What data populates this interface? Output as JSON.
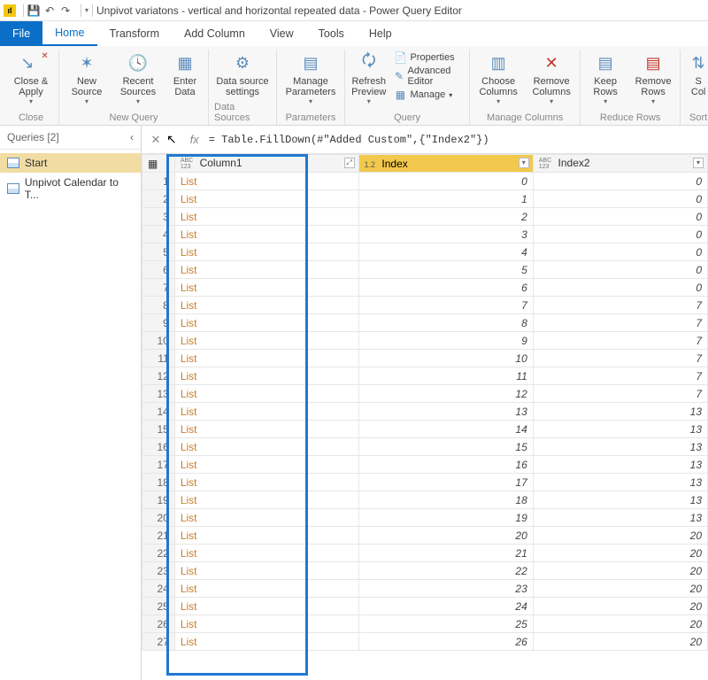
{
  "titlebar": {
    "app_icon": "▮",
    "title": "Unpivot variatons  - vertical and horizontal repeated data - Power Query Editor",
    "qat_save": "💾",
    "qat_undo": "↶",
    "qat_redo": "↷",
    "qat_dropdown": "▾"
  },
  "tabs": {
    "file": "File",
    "home": "Home",
    "transform": "Transform",
    "addcolumn": "Add Column",
    "view": "View",
    "tools": "Tools",
    "help": "Help"
  },
  "ribbon": {
    "close_apply": "Close &\nApply",
    "close_grp": "Close",
    "new_source": "New\nSource",
    "recent_sources": "Recent\nSources",
    "enter_data": "Enter\nData",
    "newquery_grp": "New Query",
    "ds_settings": "Data source\nsettings",
    "ds_grp": "Data Sources",
    "manage_params": "Manage\nParameters",
    "params_grp": "Parameters",
    "refresh_preview": "Refresh\nPreview",
    "properties": "Properties",
    "adv_editor": "Advanced Editor",
    "manage": "Manage",
    "query_grp": "Query",
    "choose_cols": "Choose\nColumns",
    "remove_cols": "Remove\nColumns",
    "mcols_grp": "Manage Columns",
    "keep_rows": "Keep\nRows",
    "remove_rows": "Remove\nRows",
    "rrows_grp": "Reduce Rows",
    "sort_cols": "S\nCol",
    "sort_grp": "Sort"
  },
  "queries": {
    "header": "Queries [2]",
    "collapse": "‹",
    "items": [
      {
        "label": "Start",
        "selected": true
      },
      {
        "label": "Unpivot Calendar to T...",
        "selected": false
      }
    ]
  },
  "formula": {
    "cancel": "✕",
    "accept": "✓",
    "fx": "fx",
    "text": "= Table.FillDown(#\"Added Custom\",{\"Index2\"})"
  },
  "grid": {
    "headers": {
      "rowcorner": "",
      "col1_type": "ABC\n123",
      "col1": "Column1",
      "col1_expander": "⤢",
      "index_type": "1.2",
      "index": "Index",
      "index2_type": "ABC\n123",
      "index2": "Index2",
      "drop": "▾"
    },
    "rows": [
      {
        "n": 1,
        "c1": "List",
        "i": 0,
        "i2": 0
      },
      {
        "n": 2,
        "c1": "List",
        "i": 1,
        "i2": 0
      },
      {
        "n": 3,
        "c1": "List",
        "i": 2,
        "i2": 0
      },
      {
        "n": 4,
        "c1": "List",
        "i": 3,
        "i2": 0
      },
      {
        "n": 5,
        "c1": "List",
        "i": 4,
        "i2": 0
      },
      {
        "n": 6,
        "c1": "List",
        "i": 5,
        "i2": 0
      },
      {
        "n": 7,
        "c1": "List",
        "i": 6,
        "i2": 0
      },
      {
        "n": 8,
        "c1": "List",
        "i": 7,
        "i2": 7
      },
      {
        "n": 9,
        "c1": "List",
        "i": 8,
        "i2": 7
      },
      {
        "n": 10,
        "c1": "List",
        "i": 9,
        "i2": 7
      },
      {
        "n": 11,
        "c1": "List",
        "i": 10,
        "i2": 7
      },
      {
        "n": 12,
        "c1": "List",
        "i": 11,
        "i2": 7
      },
      {
        "n": 13,
        "c1": "List",
        "i": 12,
        "i2": 7
      },
      {
        "n": 14,
        "c1": "List",
        "i": 13,
        "i2": 13
      },
      {
        "n": 15,
        "c1": "List",
        "i": 14,
        "i2": 13
      },
      {
        "n": 16,
        "c1": "List",
        "i": 15,
        "i2": 13
      },
      {
        "n": 17,
        "c1": "List",
        "i": 16,
        "i2": 13
      },
      {
        "n": 18,
        "c1": "List",
        "i": 17,
        "i2": 13
      },
      {
        "n": 19,
        "c1": "List",
        "i": 18,
        "i2": 13
      },
      {
        "n": 20,
        "c1": "List",
        "i": 19,
        "i2": 13
      },
      {
        "n": 21,
        "c1": "List",
        "i": 20,
        "i2": 20
      },
      {
        "n": 22,
        "c1": "List",
        "i": 21,
        "i2": 20
      },
      {
        "n": 23,
        "c1": "List",
        "i": 22,
        "i2": 20
      },
      {
        "n": 24,
        "c1": "List",
        "i": 23,
        "i2": 20
      },
      {
        "n": 25,
        "c1": "List",
        "i": 24,
        "i2": 20
      },
      {
        "n": 26,
        "c1": "List",
        "i": 25,
        "i2": 20
      },
      {
        "n": 27,
        "c1": "List",
        "i": 26,
        "i2": 20
      }
    ]
  }
}
